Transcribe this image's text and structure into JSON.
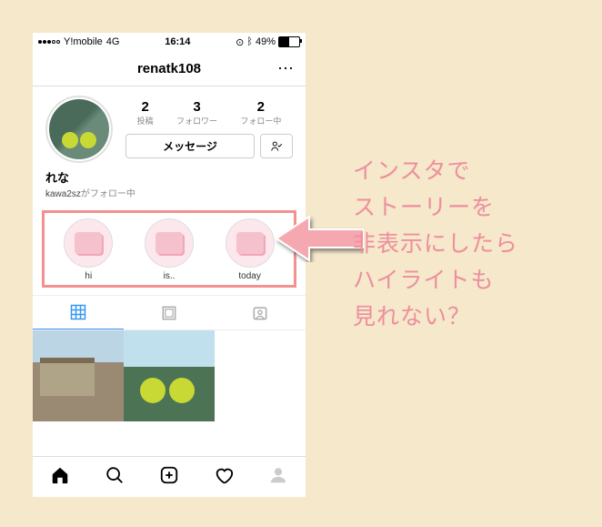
{
  "status": {
    "carrier": "Y!mobile",
    "network": "4G",
    "time": "16:14",
    "battery_pct": "49%",
    "battery_level": 49
  },
  "nav": {
    "title": "renatk108",
    "more": "⋯"
  },
  "profile": {
    "stats": [
      {
        "num": "2",
        "label": "投稿"
      },
      {
        "num": "3",
        "label": "フォロワー"
      },
      {
        "num": "2",
        "label": "フォロー中"
      }
    ],
    "message_btn": "メッセージ",
    "follow_icon": "user-check",
    "bio_name": "れな",
    "bio_sub_user": "kawa2sz",
    "bio_sub_suffix": "がフォロー中"
  },
  "highlights": [
    {
      "label": "hi"
    },
    {
      "label": "is.."
    },
    {
      "label": "today"
    }
  ],
  "caption_lines": [
    "インスタで",
    "ストーリーを",
    "非表示にしたら",
    "ハイライトも",
    "見れない？"
  ]
}
